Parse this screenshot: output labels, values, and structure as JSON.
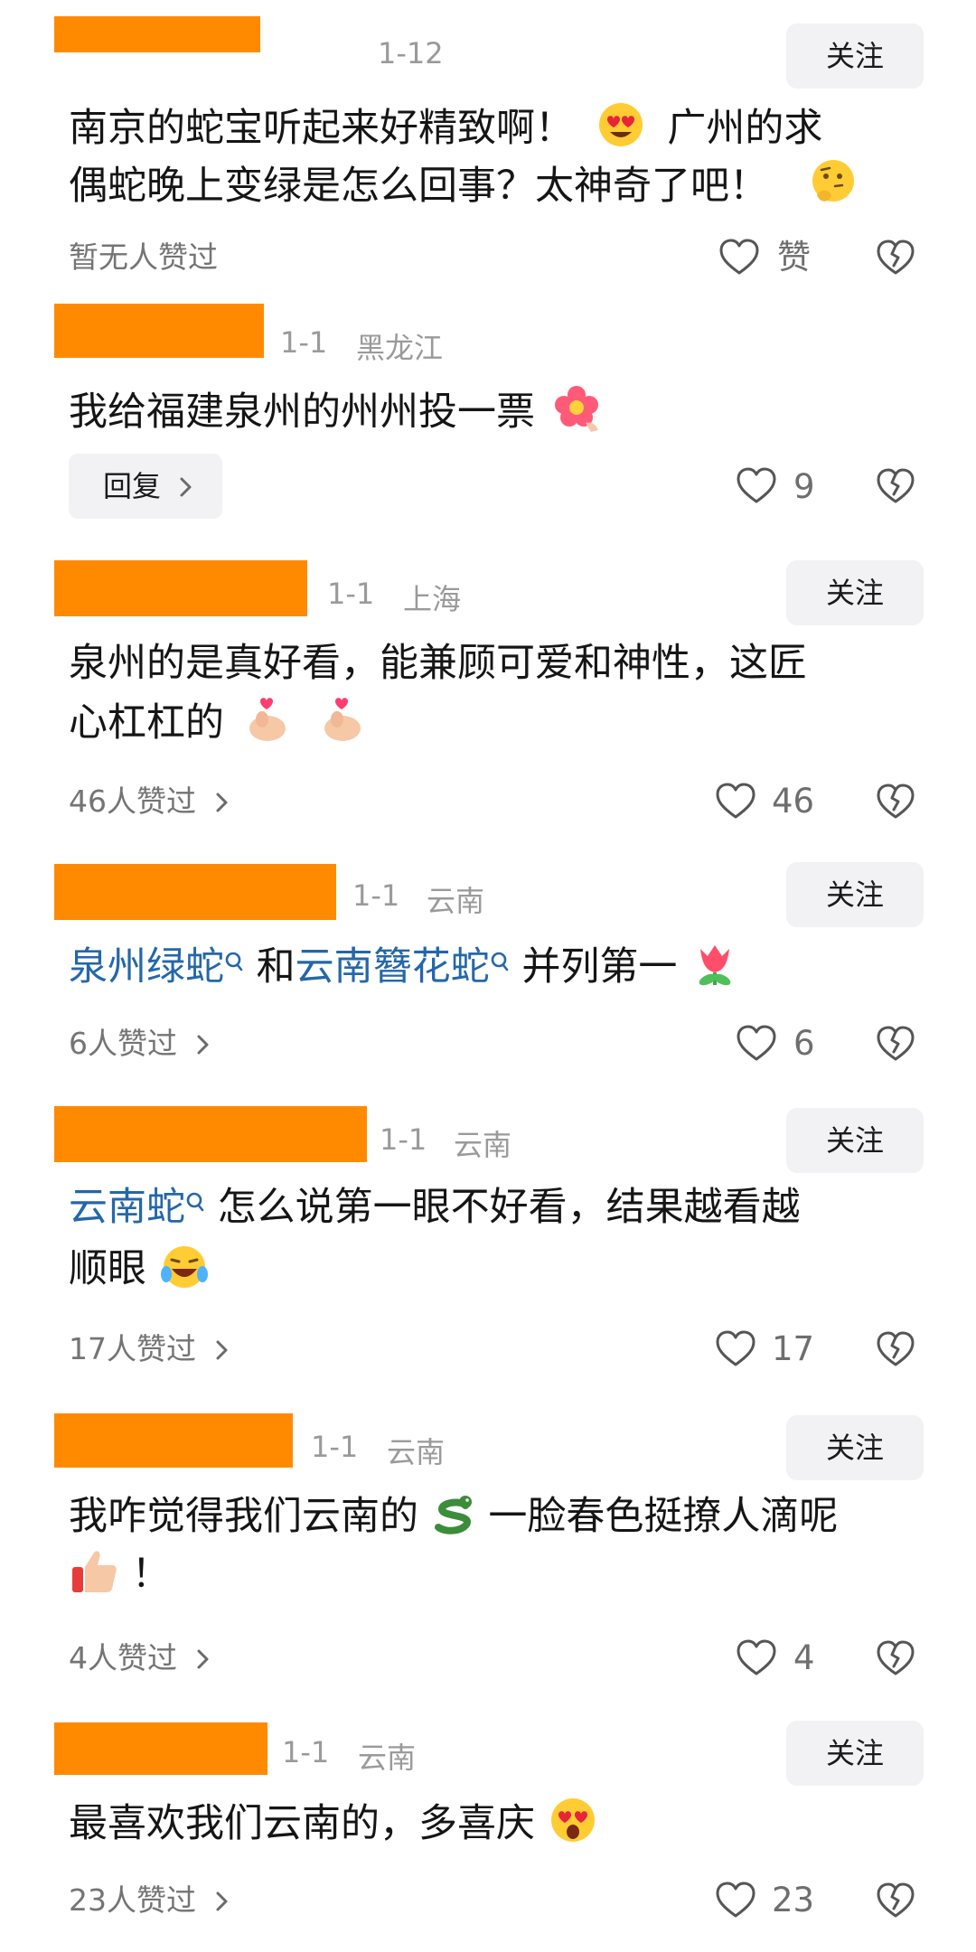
{
  "comments": [
    {
      "date": "1-12",
      "region": "",
      "follow_label": "关注",
      "lines": [
        "南京的蛇宝听起来好精致啊！",
        "广州的求",
        "偶蛇晚上变绿是怎么回事？太神奇了吧！"
      ],
      "likes_text": "暂无人赞过",
      "like_label": "赞",
      "emojis": [
        "heart-eyes-emoji",
        "thinking-emoji"
      ]
    },
    {
      "date": "1-1",
      "region": "黑龙江",
      "reply_label": "回复",
      "lines": [
        "我给福建泉州的州州投一票"
      ],
      "like_count": "9",
      "emojis": [
        "flower-emoji"
      ]
    },
    {
      "date": "1-1",
      "region": "上海",
      "follow_label": "关注",
      "lines": [
        "泉州的是真好看，能兼顾可爱和神性，这匠",
        "心杠杠的"
      ],
      "likes_text": "46人赞过",
      "like_count": "46",
      "emojis": [
        "finger-heart-emoji",
        "finger-heart-emoji"
      ]
    },
    {
      "date": "1-1",
      "region": "云南",
      "follow_label": "关注",
      "links": [
        "泉州绿蛇",
        "云南簪花蛇"
      ],
      "line_parts": [
        "和",
        "并列第一"
      ],
      "likes_text": "6人赞过",
      "like_count": "6",
      "emojis": [
        "tulip-emoji"
      ]
    },
    {
      "date": "1-1",
      "region": "云南",
      "follow_label": "关注",
      "links": [
        "云南蛇"
      ],
      "lines": [
        "怎么说第一眼不好看，结果越看越",
        "顺眼"
      ],
      "likes_text": "17人赞过",
      "like_count": "17",
      "emojis": [
        "laughing-emoji"
      ]
    },
    {
      "date": "1-1",
      "region": "云南",
      "follow_label": "关注",
      "lines": [
        "我咋觉得我们云南的",
        "一脸春色挺撩人滴呢",
        "！"
      ],
      "likes_text": "4人赞过",
      "like_count": "4",
      "emojis": [
        "snake-emoji",
        "thumbs-up-emoji"
      ]
    },
    {
      "date": "1-1",
      "region": "云南",
      "follow_label": "关注",
      "lines": [
        "最喜欢我们云南的，多喜庆"
      ],
      "likes_text": "23人赞过",
      "like_count": "23",
      "emojis": [
        "starstruck-emoji"
      ]
    }
  ],
  "colors": {
    "redaction": "#ff8a00",
    "link": "#2467a9",
    "meta": "#9a9a9a",
    "button_bg": "#f2f2f4"
  }
}
